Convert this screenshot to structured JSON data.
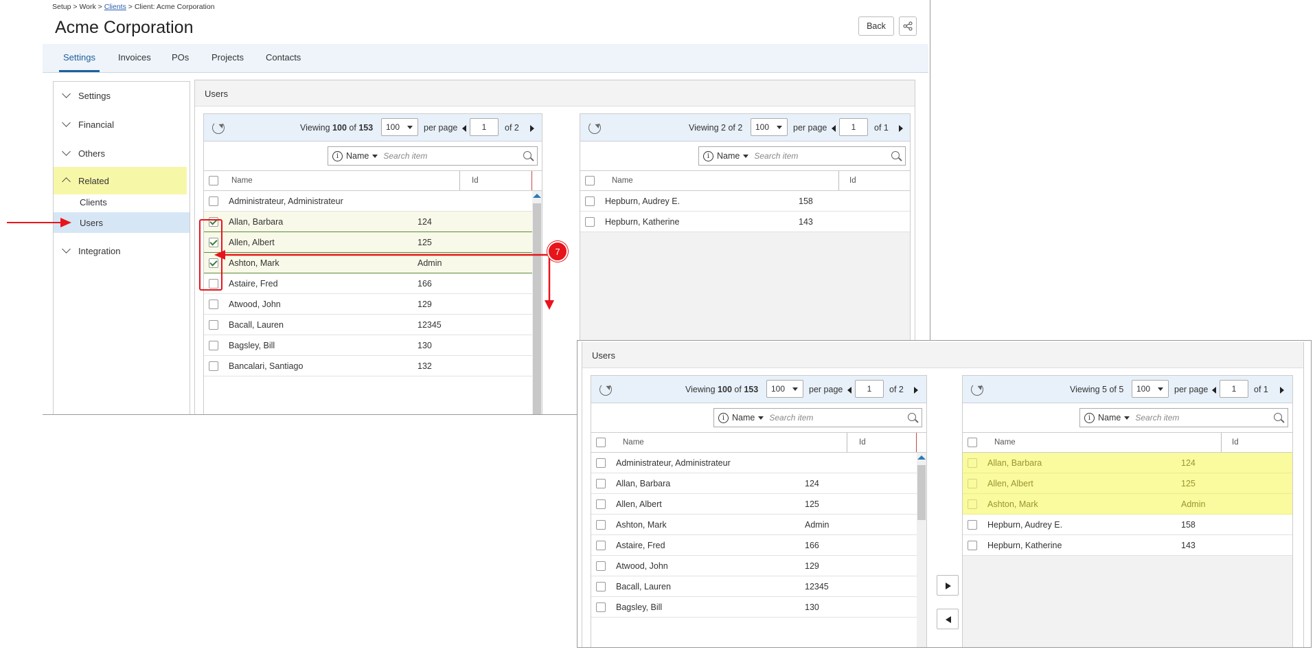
{
  "breadcrumb": {
    "setup": "Setup",
    "sep": ">",
    "work": "Work",
    "clients": "Clients",
    "client": "Client: Acme Corporation"
  },
  "page": {
    "title": "Acme Corporation",
    "back_label": "Back",
    "share_icon": "share-icon"
  },
  "tabs": [
    "Settings",
    "Invoices",
    "POs",
    "Projects",
    "Contacts"
  ],
  "active_tab": "Settings",
  "sidebar": {
    "groups": [
      "Settings",
      "Financial",
      "Others",
      "Related",
      "Integration"
    ],
    "related_items": [
      "Clients",
      "Users"
    ]
  },
  "users_panel": {
    "title": "Users"
  },
  "search": {
    "field": "Name",
    "placeholder": "Search item"
  },
  "columns": {
    "name": "Name",
    "id": "Id"
  },
  "grid_text": {
    "viewing": "Viewing",
    "of": "of",
    "per_page": "per page"
  },
  "left_grid": {
    "shown": "100",
    "total": "153",
    "page_size": "100",
    "page": "1",
    "pages": "of 2",
    "rows": [
      {
        "name": "Administrateur, Administrateur",
        "id": ""
      },
      {
        "name": "Allan, Barbara",
        "id": "124"
      },
      {
        "name": "Allen, Albert",
        "id": "125"
      },
      {
        "name": "Ashton, Mark",
        "id": "Admin"
      },
      {
        "name": "Astaire, Fred",
        "id": "166"
      },
      {
        "name": "Atwood, John",
        "id": "129"
      },
      {
        "name": "Bacall, Lauren",
        "id": "12345"
      },
      {
        "name": "Bagsley, Bill",
        "id": "130"
      },
      {
        "name": "Bancalari, Santiago",
        "id": "132"
      }
    ]
  },
  "right_grid": {
    "shown": "2",
    "total": "2",
    "page_size": "100",
    "page": "1",
    "pages": "of 1",
    "rows": [
      {
        "name": "Hepburn, Audrey E.",
        "id": "158"
      },
      {
        "name": "Hepburn, Katherine",
        "id": "143"
      }
    ]
  },
  "after_left_grid": {
    "shown": "100",
    "total": "153",
    "page_size": "100",
    "page": "1",
    "pages": "of 2",
    "rows": [
      {
        "name": "Administrateur, Administrateur",
        "id": ""
      },
      {
        "name": "Allan, Barbara",
        "id": "124"
      },
      {
        "name": "Allen, Albert",
        "id": "125"
      },
      {
        "name": "Ashton, Mark",
        "id": "Admin"
      },
      {
        "name": "Astaire, Fred",
        "id": "166"
      },
      {
        "name": "Atwood, John",
        "id": "129"
      },
      {
        "name": "Bacall, Lauren",
        "id": "12345"
      },
      {
        "name": "Bagsley, Bill",
        "id": "130"
      }
    ]
  },
  "after_right_grid": {
    "shown": "5",
    "total": "5",
    "page_size": "100",
    "page": "1",
    "pages": "of 1",
    "rows": [
      {
        "name": "Allan, Barbara",
        "id": "124"
      },
      {
        "name": "Allen, Albert",
        "id": "125"
      },
      {
        "name": "Ashton, Mark",
        "id": "Admin"
      },
      {
        "name": "Hepburn, Audrey E.",
        "id": "158"
      },
      {
        "name": "Hepburn, Katherine",
        "id": "143"
      }
    ]
  },
  "annotation": {
    "step": "7",
    "color": "#e8141b"
  },
  "colors": {
    "accent": "#1f5e9b",
    "related_highlight": "#f7f7a8",
    "users_active": "#d6e6f5",
    "added_highlight": "#fafa9e"
  }
}
